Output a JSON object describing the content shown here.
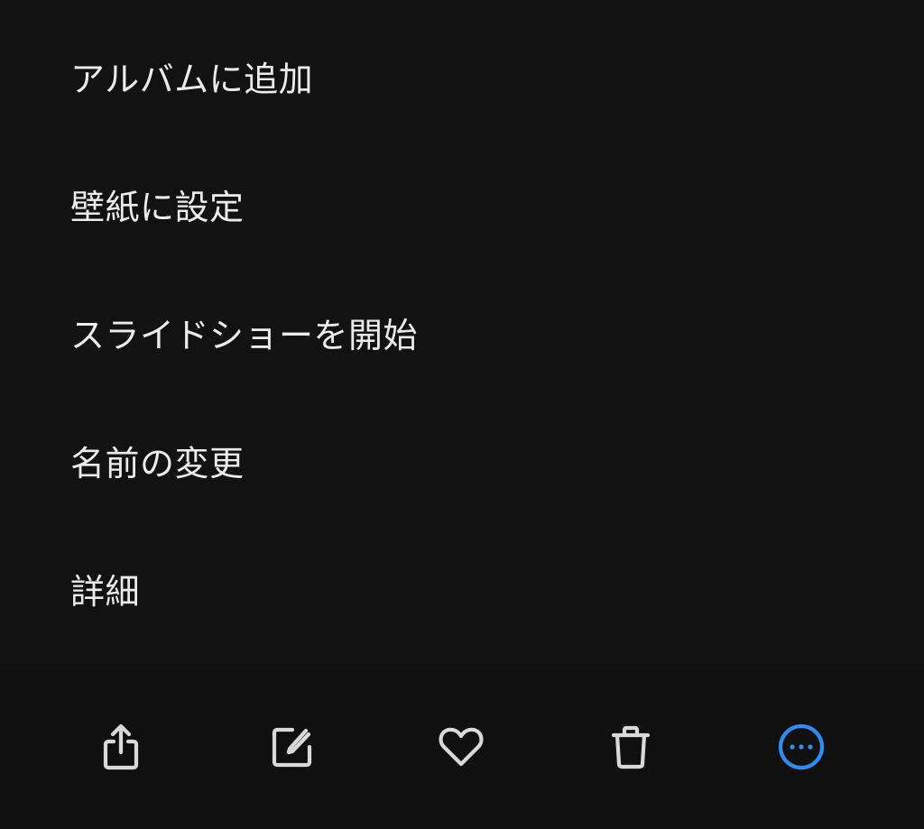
{
  "menu": {
    "items": [
      {
        "label": "アルバムに追加"
      },
      {
        "label": "壁紙に設定"
      },
      {
        "label": "スライドショーを開始"
      },
      {
        "label": "名前の変更"
      },
      {
        "label": "詳細"
      }
    ]
  },
  "toolbar": {
    "items": [
      {
        "icon": "share-icon"
      },
      {
        "icon": "edit-icon"
      },
      {
        "icon": "heart-icon"
      },
      {
        "icon": "trash-icon"
      },
      {
        "icon": "more-icon",
        "active": true
      }
    ]
  },
  "colors": {
    "background": "#101010",
    "text": "#ececec",
    "icon": "#d9d9d9",
    "accent": "#2f8cf1"
  }
}
